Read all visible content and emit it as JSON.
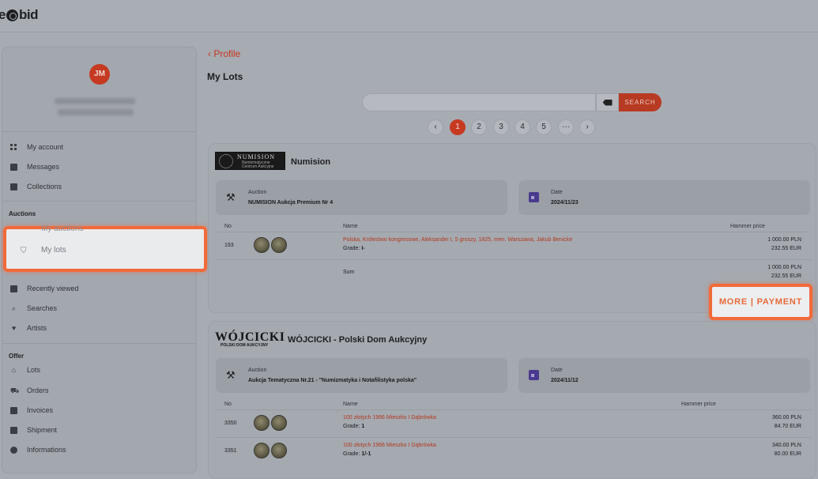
{
  "brand": {
    "logo_left": "e",
    "logo_right": "bid"
  },
  "sidebar": {
    "avatar_initials": "JM",
    "items_account": [
      {
        "label": "My account",
        "icon": "grid-icon"
      },
      {
        "label": "Messages",
        "icon": "message-icon"
      },
      {
        "label": "Collections",
        "icon": "collection-icon"
      }
    ],
    "auctions_header": "Auctions",
    "my_auctions_partial": "My auctions",
    "my_lots": "My lots",
    "items_auctions": [
      {
        "label": "Recently viewed",
        "icon": "document-icon"
      },
      {
        "label": "Searches",
        "icon": "search-icon"
      },
      {
        "label": "Artists",
        "icon": "heart-icon"
      }
    ],
    "offer_header": "Offer",
    "items_offer": [
      {
        "label": "Lots",
        "icon": "bank-icon"
      },
      {
        "label": "Orders",
        "icon": "cart-icon"
      },
      {
        "label": "Invoices",
        "icon": "invoice-icon"
      },
      {
        "label": "Shipment",
        "icon": "truck-icon"
      },
      {
        "label": "Informations",
        "icon": "info-icon"
      }
    ]
  },
  "main": {
    "back_label": "Profile",
    "title": "My Lots",
    "search": {
      "placeholder": "",
      "button": "SEARCH"
    },
    "pagination": [
      "1",
      "2",
      "3",
      "4",
      "5",
      "···"
    ],
    "cards": [
      {
        "house": "Numision",
        "logo_text": "NUMISION",
        "logo_sub": "Numizmatyczne Centrum Aukcyjne",
        "auction_label": "Auction",
        "auction_value": "NUMISION Aukcja Premium Nr 4",
        "date_label": "Date",
        "date_value": "2024/11/23",
        "col_no": "No",
        "col_name": "Name",
        "col_price": "Hammer price",
        "rows": [
          {
            "no": "193",
            "name": "Polska, Królestwo kongresowe, Aleksander I, 5 groszy, 1825, men. Warszawa, Jakub Benicke",
            "grade_label": "Grade:",
            "grade": "I-",
            "price_pln": "1 000.00 PLN",
            "price_eur": "232.55 EUR"
          }
        ],
        "sum_label": "Sum",
        "sum_pln": "1 000.00 PLN",
        "sum_eur": "232.55 EUR",
        "more_label": "MORE | PAYMENT"
      },
      {
        "house": "WÓJCICKI - Polski Dom Aukcyjny",
        "logo_text": "WÓJCICKI",
        "logo_sub": "POLSKI DOM AUKCYJNY",
        "auction_label": "Auction",
        "auction_value": "Aukcja Tematyczna Nr.21 - \"Numizmatyka i Notafilistyka polska\"",
        "date_label": "Date",
        "date_value": "2024/11/12",
        "col_no": "No",
        "col_name": "Name",
        "col_price": "Hammer price",
        "rows": [
          {
            "no": "3350",
            "name": "100 złotych 1966 Mieszko I Dąbrówka",
            "grade_label": "Grade:",
            "grade": "1",
            "price_pln": "360.00 PLN",
            "price_eur": "84.70 EUR"
          },
          {
            "no": "3351",
            "name": "100 złotych 1966 Mieszko I Dąbrówka",
            "grade_label": "Grade:",
            "grade": "1/-1",
            "price_pln": "340.00 PLN",
            "price_eur": "80.00 EUR"
          }
        ]
      }
    ]
  }
}
